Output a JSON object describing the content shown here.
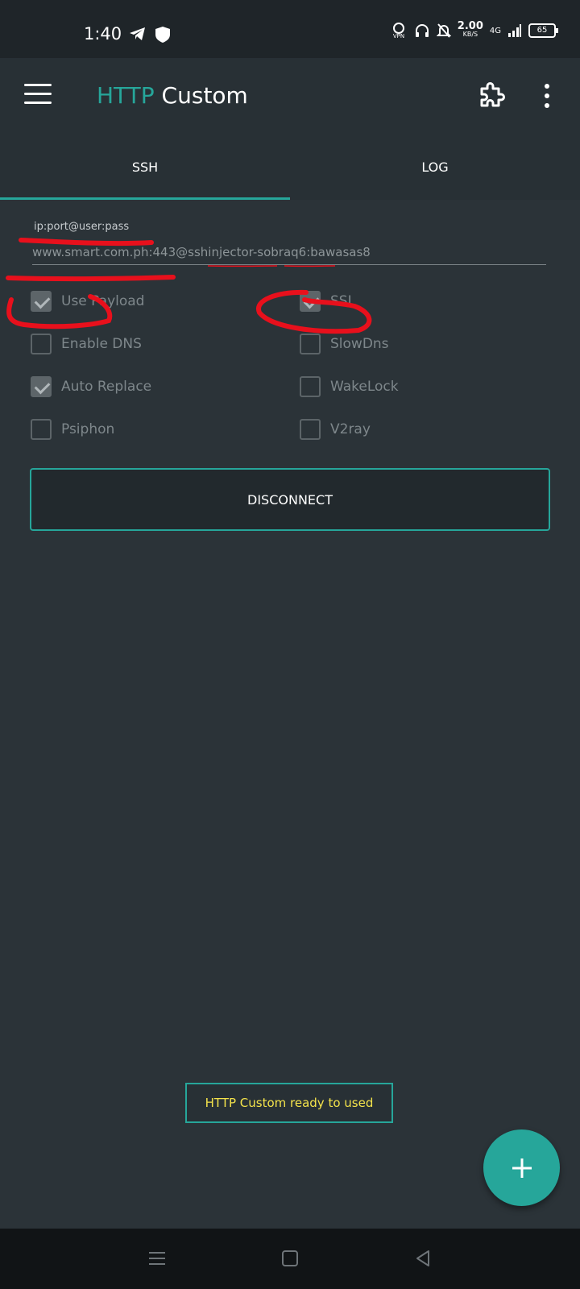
{
  "status_bar": {
    "time": "1:40",
    "speed_value": "2.00",
    "speed_unit": "KB/S",
    "network": "4G",
    "battery": "65"
  },
  "app_bar": {
    "title_http": "HTTP",
    "title_custom": " Custom",
    "accent_color": "#26a69a"
  },
  "tabs": [
    {
      "label": "SSH",
      "selected": true
    },
    {
      "label": "LOG",
      "selected": false
    }
  ],
  "ssh": {
    "field_label": "ip:port@user:pass",
    "field_value": "www.smart.com.ph:443@sshinjector-sobraq6:bawasas8"
  },
  "options": [
    {
      "label": "Use Payload",
      "checked": true
    },
    {
      "label": "SSL",
      "checked": true
    },
    {
      "label": "Enable DNS",
      "checked": false
    },
    {
      "label": "SlowDns",
      "checked": false
    },
    {
      "label": "Auto Replace",
      "checked": true
    },
    {
      "label": "WakeLock",
      "checked": false
    },
    {
      "label": "Psiphon",
      "checked": false
    },
    {
      "label": "V2ray",
      "checked": false
    }
  ],
  "disconnect_label": "DISCONNECT",
  "toast_text": "HTTP Custom ready to used"
}
